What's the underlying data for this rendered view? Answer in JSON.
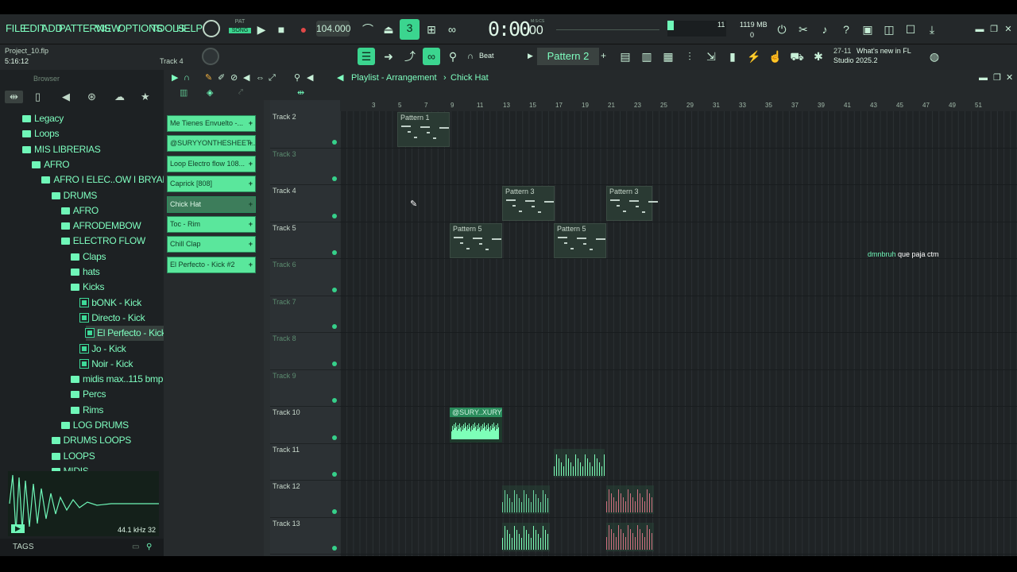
{
  "menu": [
    "FILE",
    "EDIT",
    "ADD",
    "PATTERNS",
    "VIEW",
    "OPTIONS",
    "TOOLS",
    "HELP"
  ],
  "transport": {
    "pat_label": "PAT",
    "song_label": "SONG",
    "tempo": "104.000",
    "time": "0:00",
    "time_sub": "00",
    "time_unit": "M:S:CS"
  },
  "cpu": {
    "value": "11",
    "memory": "1119 MB",
    "voices": "0"
  },
  "project": {
    "file": "Project_10.flp",
    "time": "5:16:12",
    "track_label": "Track 4"
  },
  "snap": {
    "label": "Beat"
  },
  "pattern_selector": {
    "label": "Pattern 2"
  },
  "news": {
    "date": "27-11",
    "headline": "What's new in FL",
    "subline": "Studio 2025.2"
  },
  "browser": {
    "title": "Browser",
    "items": [
      {
        "label": "Legacy",
        "type": "folder",
        "indent": 0
      },
      {
        "label": "Loops",
        "type": "folder",
        "indent": 0
      },
      {
        "label": "MIS LIBRERIAS",
        "type": "folder",
        "indent": 0
      },
      {
        "label": "AFRO",
        "type": "folder",
        "indent": 1
      },
      {
        "label": "AFRO I ELEC..OW I BRYARTZZ",
        "type": "folder",
        "indent": 2
      },
      {
        "label": "DRUMS",
        "type": "folder",
        "indent": 3
      },
      {
        "label": "AFRO",
        "type": "folder",
        "indent": 4
      },
      {
        "label": "AFRODEMBOW",
        "type": "folder",
        "indent": 4
      },
      {
        "label": "ELECTRO FLOW",
        "type": "folder",
        "indent": 4
      },
      {
        "label": "Claps",
        "type": "folder",
        "indent": 5
      },
      {
        "label": "hats",
        "type": "folder",
        "indent": 5
      },
      {
        "label": "Kicks",
        "type": "folder",
        "indent": 5
      },
      {
        "label": "bONK - Kick",
        "type": "audio",
        "indent": 6
      },
      {
        "label": "Directo - Kick",
        "type": "audio",
        "indent": 6
      },
      {
        "label": "El Perfecto - Kick",
        "type": "audio",
        "indent": 6,
        "selected": true
      },
      {
        "label": "Jo - Kick",
        "type": "audio",
        "indent": 6
      },
      {
        "label": "Noir - Kick",
        "type": "audio",
        "indent": 6
      },
      {
        "label": "midis max..115 bmp",
        "type": "folder",
        "indent": 5
      },
      {
        "label": "Percs",
        "type": "folder",
        "indent": 5
      },
      {
        "label": "Rims",
        "type": "folder",
        "indent": 5
      },
      {
        "label": "LOG DRUMS",
        "type": "folder",
        "indent": 4
      },
      {
        "label": "DRUMS LOOPS",
        "type": "folder",
        "indent": 3
      },
      {
        "label": "LOOPS",
        "type": "folder",
        "indent": 3
      },
      {
        "label": "MIDIS",
        "type": "folder",
        "indent": 3
      }
    ],
    "sample_info": "44.1 kHz 32",
    "tags_label": "TAGS"
  },
  "playlist": {
    "breadcrumb": [
      "Playlist - Arrangement",
      "Chick Hat"
    ],
    "clips": [
      "Me Tienes Envuelto -...",
      "@SURYYONTHESHEET...",
      "Loop Electro flow 108...",
      "Caprick [808]",
      "Chick Hat",
      "Toc - Rim",
      "Chill Clap",
      "El Perfecto - Kick #2"
    ],
    "selected_clip": "Chick Hat",
    "ruler": [
      "3",
      "5",
      "7",
      "9",
      "11",
      "13",
      "15",
      "17",
      "19",
      "21",
      "23",
      "25",
      "29",
      "31",
      "33",
      "35",
      "37",
      "39",
      "41",
      "43",
      "45",
      "47",
      "49",
      "51"
    ],
    "tracks": [
      {
        "name": "Track 2",
        "empty": false
      },
      {
        "name": "Track 3",
        "empty": true
      },
      {
        "name": "Track 4",
        "empty": false
      },
      {
        "name": "Track 5",
        "empty": false
      },
      {
        "name": "Track 6",
        "empty": true
      },
      {
        "name": "Track 7",
        "empty": true
      },
      {
        "name": "Track 8",
        "empty": true
      },
      {
        "name": "Track 9",
        "empty": true
      },
      {
        "name": "Track 10",
        "empty": false
      },
      {
        "name": "Track 11",
        "empty": false
      },
      {
        "name": "Track 12",
        "empty": false
      },
      {
        "name": "Track 13",
        "empty": false
      }
    ],
    "patterns": [
      {
        "label": "Pattern 1",
        "track": 0
      },
      {
        "label": "Pattern 3",
        "track": 2
      },
      {
        "label": "Pattern 3",
        "track": 2
      },
      {
        "label": "Pattern 5",
        "track": 3
      },
      {
        "label": "Pattern 5",
        "track": 3
      }
    ],
    "audio_clip_label": "@SURY..XURY"
  },
  "chat": {
    "user": "dmnbruh",
    "message": "que paja ctm"
  }
}
